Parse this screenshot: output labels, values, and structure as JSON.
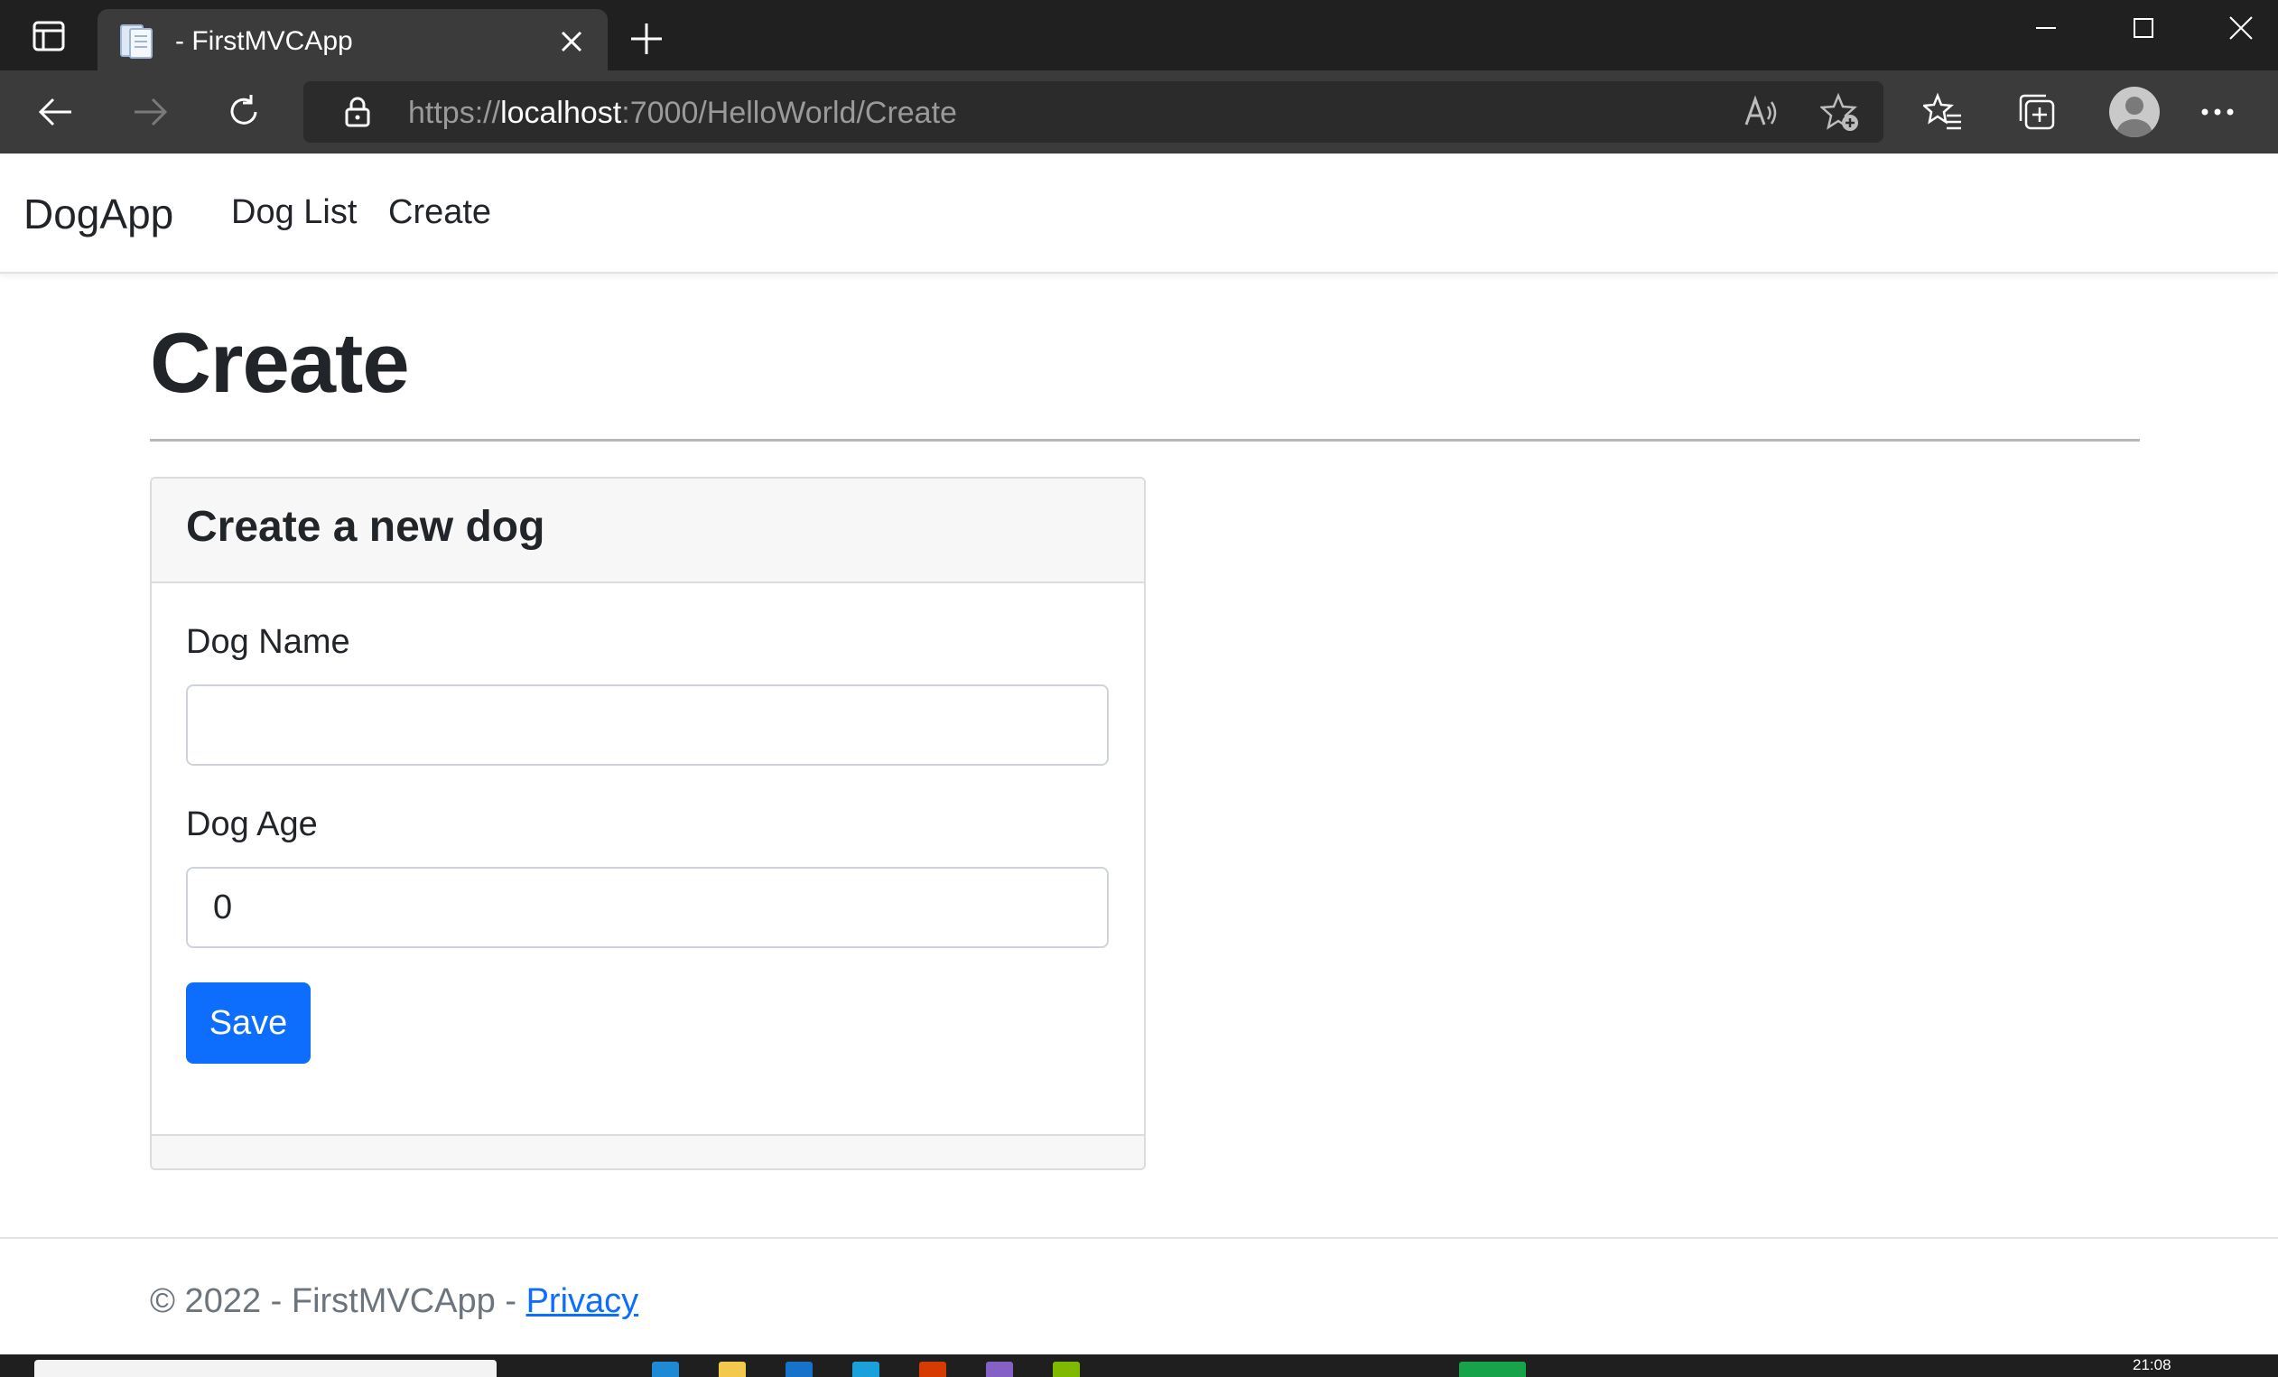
{
  "browser": {
    "tab_title": "- FirstMVCApp",
    "url_scheme": "https://",
    "url_host": "localhost",
    "url_rest": ":7000/HelloWorld/Create"
  },
  "nav": {
    "brand": "DogApp",
    "links": [
      "Dog List",
      "Create"
    ]
  },
  "main": {
    "title": "Create",
    "card": {
      "header": "Create a new dog",
      "fields": [
        {
          "label": "Dog Name",
          "value": ""
        },
        {
          "label": "Dog Age",
          "value": "0"
        }
      ],
      "save_label": "Save"
    }
  },
  "footer": {
    "text": "© 2022 - FirstMVCApp - ",
    "privacy_label": "Privacy"
  },
  "taskbar": {
    "time": "21:08"
  },
  "colors": {
    "primary": "#0d6efd",
    "chrome_dark": "#202020",
    "toolbar": "#3b3b3b"
  }
}
